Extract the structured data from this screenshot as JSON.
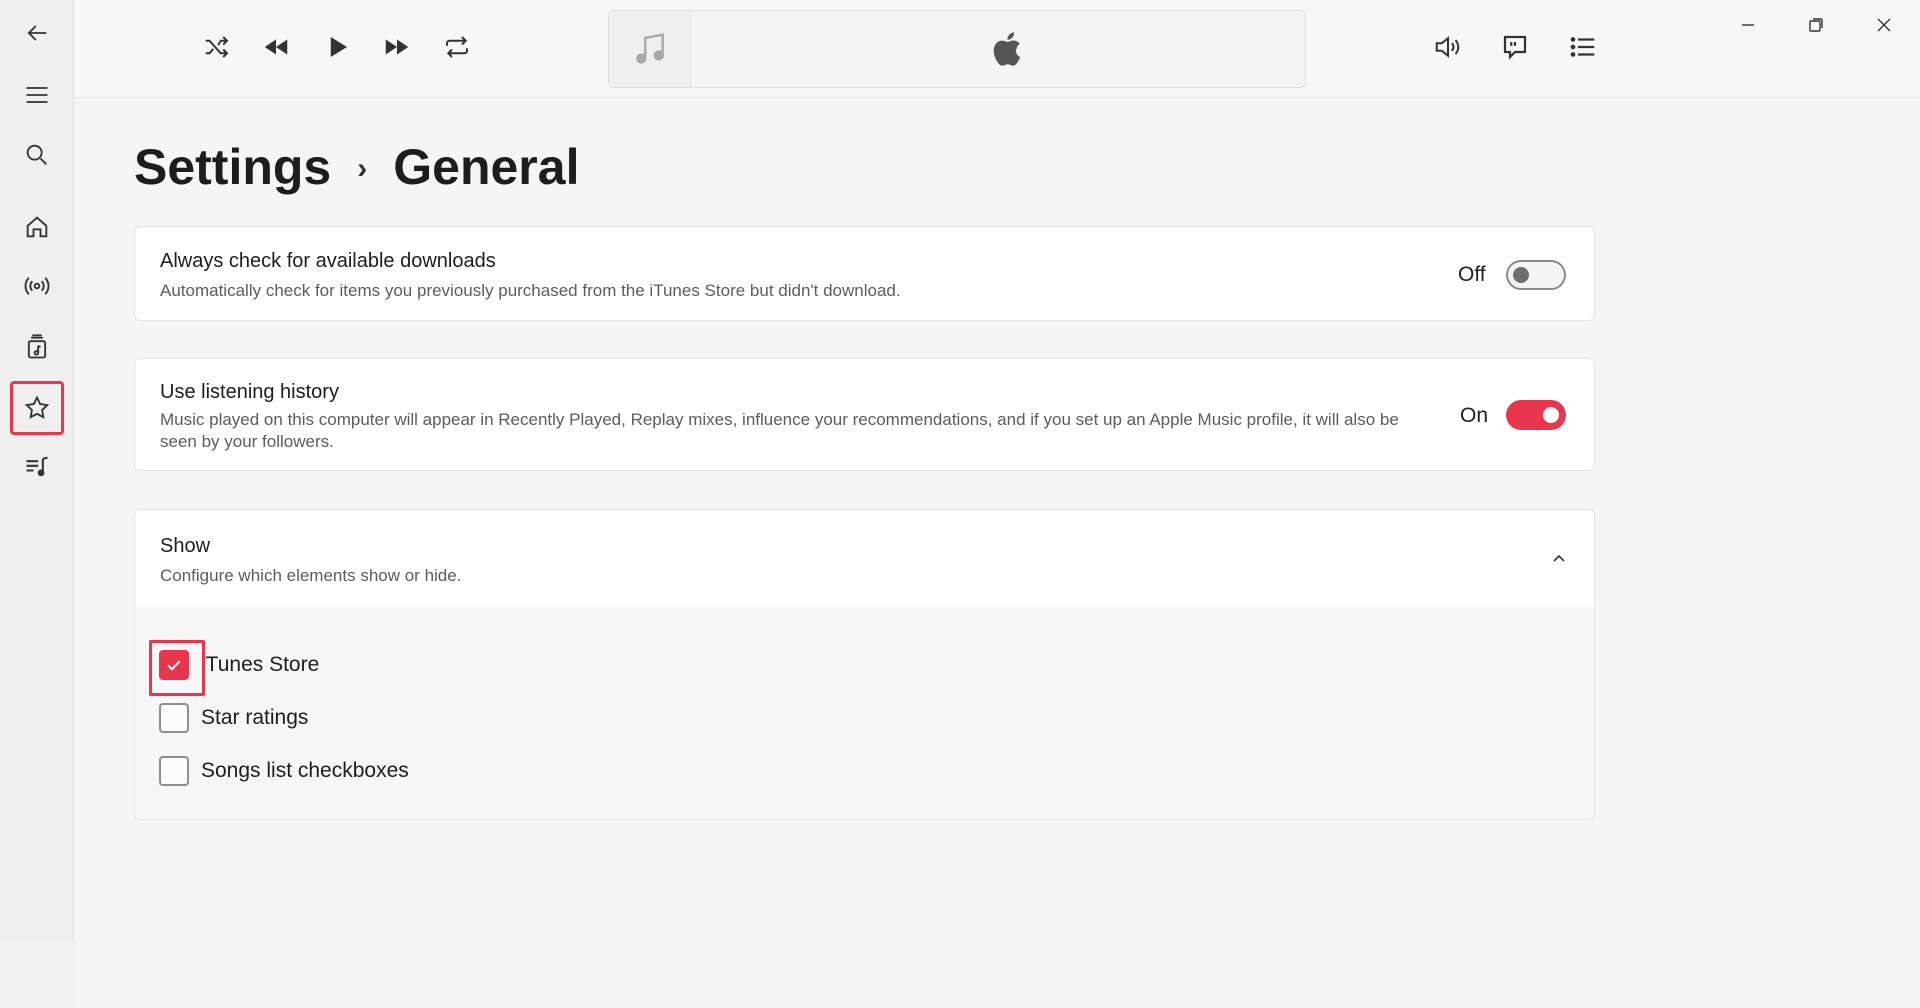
{
  "sidebar": {
    "items": [
      {
        "icon": "back-arrow-icon"
      },
      {
        "icon": "hamburger-menu-icon"
      },
      {
        "icon": "search-icon"
      },
      {
        "icon": "home-icon"
      },
      {
        "icon": "radio-icon"
      },
      {
        "icon": "library-icon"
      },
      {
        "icon": "star-icon",
        "selected": true
      },
      {
        "icon": "playlist-icon"
      }
    ]
  },
  "toolbar": {
    "icons": [
      "shuffle-icon",
      "previous-icon",
      "play-icon",
      "next-icon",
      "repeat-icon",
      "volume-icon",
      "lyrics-icon",
      "queue-icon"
    ]
  },
  "breadcrumb": {
    "parent": "Settings",
    "separator": "›",
    "current": "General"
  },
  "settings": {
    "downloads": {
      "title": "Always check for available downloads",
      "description": "Automatically check for items you previously purchased from the iTunes Store but didn't download.",
      "state_label": "Off",
      "enabled": false
    },
    "history": {
      "title": "Use listening history",
      "description": "Music played on this computer will appear in Recently Played, Replay mixes, influence your recommendations, and if you set up an Apple Music profile, it will also be seen by your followers.",
      "state_label": "On",
      "enabled": true
    },
    "show": {
      "title": "Show",
      "description": "Configure which elements show or hide.",
      "expanded": true,
      "options": [
        {
          "label": "iTunes Store",
          "checked": true
        },
        {
          "label": "Star ratings",
          "checked": false
        },
        {
          "label": "Songs list checkboxes",
          "checked": false
        }
      ]
    }
  },
  "colors": {
    "accent": "#e8364e",
    "background": "#f5f5f5",
    "card": "#ffffff"
  }
}
